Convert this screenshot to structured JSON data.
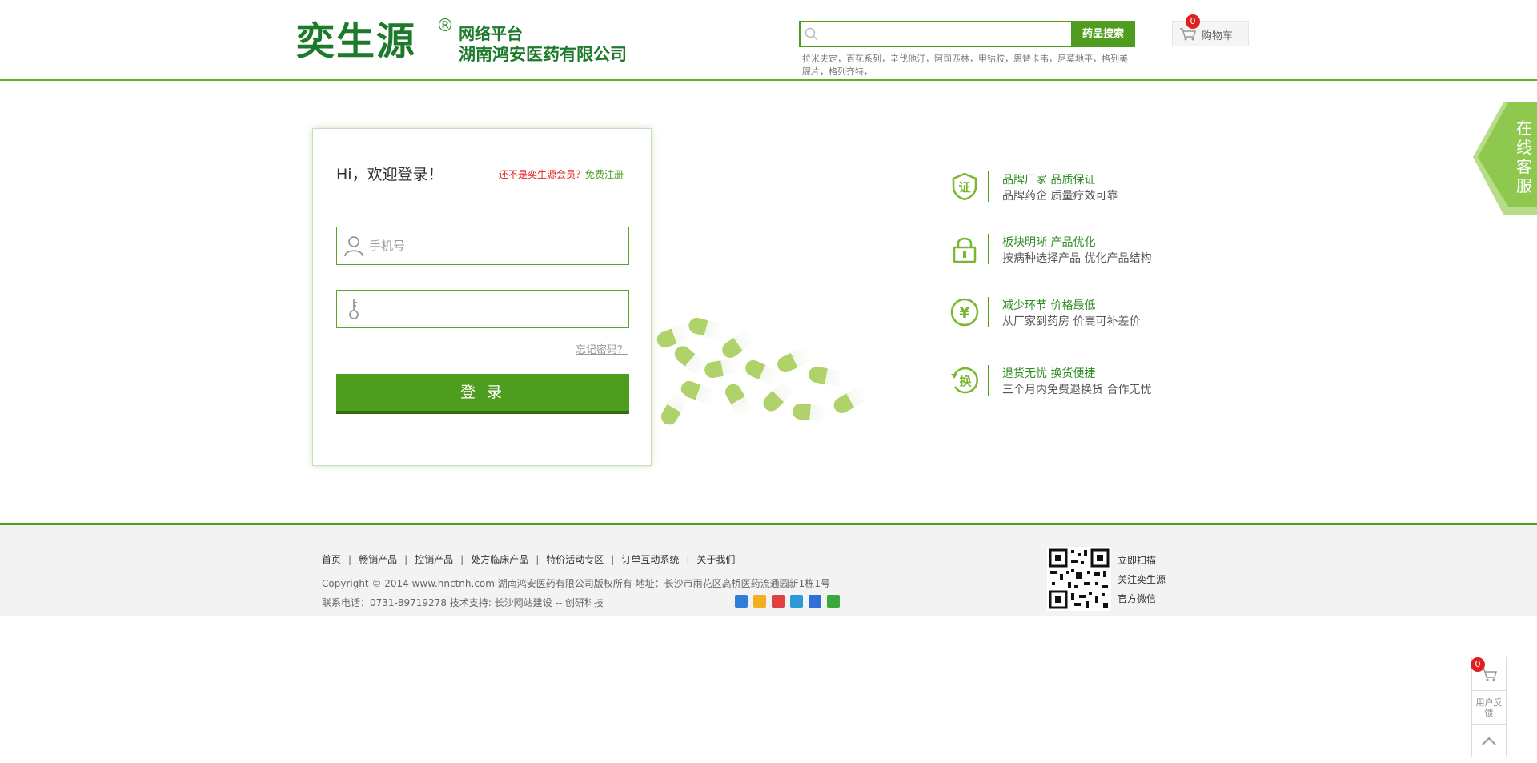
{
  "header": {
    "logo_main": "奕生源",
    "logo_reg": "®",
    "logo_sub1": "网络平台",
    "logo_sub2": "湖南鸿安医药有限公司",
    "search_placeholder": "",
    "search_button": "药品搜索",
    "hot_words": "拉米夫定，百花系列，辛伐他汀，阿司匹林，甲钴胺，恩替卡韦，尼莫地平，格列美脲片，格列齐特，",
    "cart_label": "购物车",
    "cart_count": "0"
  },
  "service_tab": {
    "text": "在线客服"
  },
  "login": {
    "title": "Hi，欢迎登录！",
    "register_tip": "还不是奕生源会员？",
    "register_link": "免费注册",
    "phone_placeholder": "手机号",
    "password_placeholder": "",
    "forgot": "忘记密码？",
    "submit": "登 录"
  },
  "features": [
    {
      "icon": "certificate-icon",
      "glyph": "证",
      "title": "品牌厂家 品质保证",
      "desc": "品牌药企 质量疗效可靠"
    },
    {
      "icon": "lock-icon",
      "glyph": "",
      "title": "板块明晰 产品优化",
      "desc": "按病种选择产品 优化产品结构"
    },
    {
      "icon": "yen-icon",
      "glyph": "¥",
      "title": "减少环节 价格最低",
      "desc": "从厂家到药房 价高可补差价"
    },
    {
      "icon": "exchange-icon",
      "glyph": "换",
      "title": "退货无忧 换货便捷",
      "desc": "三个月内免费退换货 合作无忧"
    }
  ],
  "footer": {
    "nav": [
      "首页",
      "畅销产品",
      "控销产品",
      "处方临床产品",
      "特价活动专区",
      "订单互动系统",
      "关于我们"
    ],
    "copyright": "Copyright © 2014 www.hnctnh.com   湖南鸿安医药有限公司版权所有   地址：长沙市雨花区高桥医药流通园新1栋1号",
    "contact": "联系电话：0731-89719278   技术支持: 长沙网站建设 -- 创研科技",
    "qr_lines": [
      "立即扫描",
      "关注奕生源",
      "官方微信"
    ],
    "share_colors": [
      "#2f7fd8",
      "#f2b01e",
      "#e04040",
      "#2a9ad8",
      "#2f6fd8",
      "#3aa83a"
    ]
  },
  "float_tools": {
    "cart_count": "0",
    "feedback": "用户反馈"
  },
  "colors": {
    "brand_green": "#4f9d1e",
    "accent_red": "#e02020",
    "logo_green": "#1d7a2b"
  }
}
